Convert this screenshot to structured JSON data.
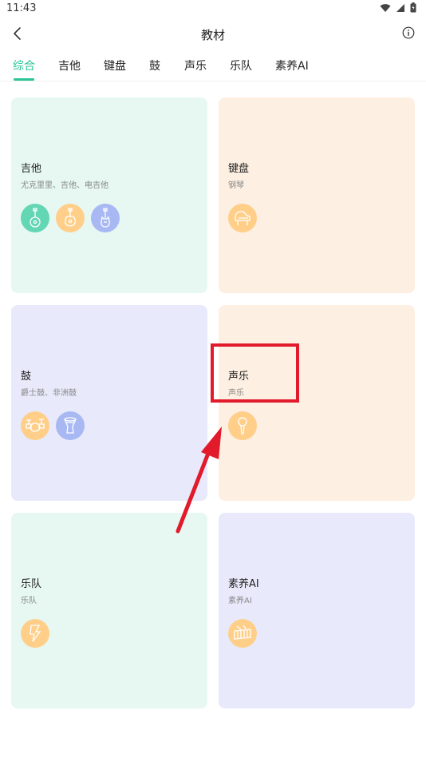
{
  "status_bar": {
    "time": "11:43"
  },
  "header": {
    "title": "教材"
  },
  "tabs": [
    {
      "label": "综合",
      "active": true
    },
    {
      "label": "吉他",
      "active": false
    },
    {
      "label": "键盘",
      "active": false
    },
    {
      "label": "鼓",
      "active": false
    },
    {
      "label": "声乐",
      "active": false
    },
    {
      "label": "乐队",
      "active": false
    },
    {
      "label": "素养AI",
      "active": false
    }
  ],
  "cards": [
    {
      "title": "吉他",
      "subtitle": "尤克里里、吉他、电吉他",
      "icons": [
        "ukulele-icon",
        "acoustic-guitar-icon",
        "electric-guitar-icon"
      ]
    },
    {
      "title": "键盘",
      "subtitle": "钢琴",
      "icons": [
        "piano-icon"
      ]
    },
    {
      "title": "鼓",
      "subtitle": "爵士鼓、非洲鼓",
      "icons": [
        "drum-kit-icon",
        "djembe-icon"
      ]
    },
    {
      "title": "声乐",
      "subtitle": "声乐",
      "icons": [
        "microphone-icon"
      ]
    },
    {
      "title": "乐队",
      "subtitle": "乐队",
      "icons": [
        "band-icon"
      ]
    },
    {
      "title": "素养AI",
      "subtitle": "素养AI",
      "icons": [
        "xylophone-icon"
      ]
    }
  ],
  "colors": {
    "accent": "#2cc598",
    "annotation": "#e11a2c"
  }
}
